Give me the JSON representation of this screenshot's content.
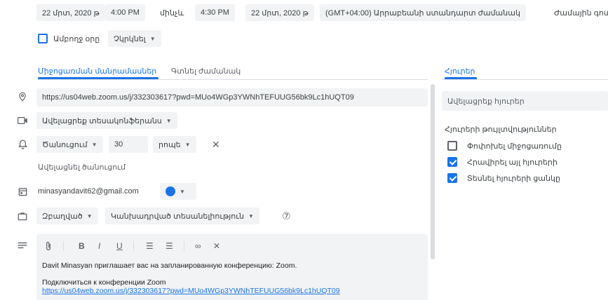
{
  "datetime": {
    "start_date": "22 մրտ, 2020 թ",
    "start_time": "4:00 PM",
    "to_label": "մինչև",
    "end_time": "4:30 PM",
    "end_date": "22 մրտ, 2020 թ",
    "timezone": "(GMT+04:00) Արրաբեանի ստանդարտ ժամանակ",
    "timezone_tail": "Ժամային գոտ"
  },
  "all_day": {
    "label": "Ամբողջ օրը",
    "repeat": "Չկրկնել"
  },
  "tabs": {
    "details": "Միջոցառման մանրամասներ",
    "find_time": "Գտնել ժամանակ",
    "guests": "Հյուրեր"
  },
  "location": {
    "value": "https://us04web.zoom.us/j/332303617?pwd=MUo4WGp3YWNhTEFUUG56bk9Lc1hUQT09"
  },
  "video": {
    "label": "Ավելացրեք տեսակոնֆերանս"
  },
  "notification": {
    "type": "Ծանուցում",
    "value": "30",
    "unit": "րոպե",
    "add_label": "Ավելացնել ծանուցում"
  },
  "calendar": {
    "email": "minasyandavit62@gmail.com",
    "color": "#1a73e8"
  },
  "status": {
    "busy": "Զբաղված",
    "visibility": "Կանխադրված տեսանելիություն"
  },
  "description": {
    "line1": "Davit Minasyan приглашает вас на запланированную конференцию: Zoom.",
    "line2": "Подключиться к конференции Zoom",
    "link": "https://us04web.zoom.us/j/332303617?pwd=MUo4WGp3YWNhTEFUUG56bk9Lc1hUQT09"
  },
  "guests_panel": {
    "add_placeholder": "Ավելացրեք հյուրեր",
    "permissions_title": "Հյուրերի թույլտվություններ",
    "perm_modify": "Փոփոխել միջոցառումը",
    "perm_invite": "Հրավիրել այլ հյուրերի",
    "perm_see_list": "Տեսնել հյուրերի ցանկը"
  },
  "icons": {
    "help": "⑦",
    "attach": "⊘",
    "bold": "B",
    "italic": "I",
    "underline": "U",
    "numbered_list": "☰",
    "bullet_list": "☰",
    "link": "∞",
    "clear_format": "✕"
  }
}
